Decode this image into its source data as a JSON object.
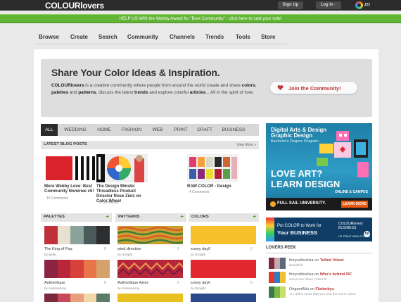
{
  "topbar": {
    "logo": "COLOURlovers",
    "signup_label": "Sign Up",
    "login_label": "Log In",
    "login_arrow": "▾"
  },
  "banner": {
    "text": "HELP US WIN the Webby Award for \"Best Community\" - click here to cast your vote!"
  },
  "nav": {
    "items": [
      "Browse",
      "Create",
      "Search",
      "Community",
      "Channels",
      "Trends",
      "Tools",
      "Store"
    ]
  },
  "hero": {
    "title": "Share Your Color Ideas & Inspiration.",
    "text_parts": [
      "COLOURlovers",
      " is a creative community where people from around the world create and share ",
      "colors",
      ", ",
      "palettes",
      " and ",
      "patterns",
      ", discuss the latest ",
      "trends",
      " and explore colorful ",
      "articles",
      "... All in the spirit of love."
    ],
    "join_label": "Join the Community!"
  },
  "tabs": [
    "ALL",
    "WEDDING",
    "HOME",
    "FASHION",
    "WEB",
    "PRINT",
    "CRAFT",
    "BUSINESS"
  ],
  "blog": {
    "header": "LATEST BLOG POSTS",
    "view_more": "View More »",
    "posts": [
      {
        "title": "More Webby Love: Best Community Nominee x5!",
        "comments": "13 Comments"
      },
      {
        "title": "The Design Minute: Threadless Product Director Rose Zietz on Color Wheel",
        "comments": "3 Comments"
      },
      {
        "title": "RAW COLOR - Design",
        "comments": "4 Comments"
      }
    ]
  },
  "palettes": {
    "header": "PALETTES",
    "plus": "+",
    "items": [
      {
        "name": "The King of Pop.",
        "user": "by kjelle_",
        "count": "0",
        "colors": [
          "#c0303a",
          "#e9e1cf",
          "#8aa39a",
          "#4a5a5b",
          "#2d2e2f"
        ]
      },
      {
        "name": "Authentique",
        "user": "by missmummy",
        "count": "0",
        "colors": [
          "#8b2342",
          "#b8263c",
          "#d8403c",
          "#e8744a",
          "#d4a26a"
        ]
      }
    ]
  },
  "patterns": {
    "header": "PATTERNS",
    "plus": "+",
    "items": [
      {
        "name": "wind direction",
        "user": "by Dsnight",
        "count": "0"
      },
      {
        "name": "Authentique Aztec",
        "user": "by missmummy",
        "count": "0"
      }
    ]
  },
  "colors_section": {
    "header": "COLORS",
    "plus": "+",
    "items": [
      {
        "name": "sunny day0",
        "user": "by Dsnight",
        "count": "0",
        "hex": "#f5c02a"
      },
      {
        "name": "sunny day0",
        "user": "by Dsnight",
        "count": "0",
        "hex": "#e3272f"
      }
    ]
  },
  "ad1": {
    "line1": "Digital Arts & Design",
    "line2": "Graphic Design",
    "line3": "Bachelor's Degree Program",
    "big1": "LOVE ART?",
    "big2": "LEARN DESIGN",
    "online": "ONLINE & CAMPUS",
    "school": "FULL SAIL UNIVERSITY.",
    "cta": "LEARN MORE"
  },
  "ad2": {
    "line1": "Put COLOR to Work for",
    "line2": "Your BUSINESS",
    "brand": "COLOURlovers BUSINESS",
    "brand_sub": "HP PRINT WEB STUDIO",
    "hp": "hp"
  },
  "peek": {
    "header": "LOVERS PEEK",
    "items": [
      {
        "user": "theycallmelisa",
        "action": " on ",
        "target": "Tufted Velvet",
        "note": "beautiful!",
        "thumb": [
          "#7a2a3a",
          "#c8a8b0",
          "#5a6a7a"
        ]
      },
      {
        "user": "theycallmelisa",
        "action": " on ",
        "target": "Who's behind RC",
        "note": "wow! love these colours!!",
        "thumb": [
          "#e3392a",
          "#2a7fc8",
          "#f0c030"
        ]
      },
      {
        "user": "OrigamiMei",
        "action": " on ",
        "target": "Flutterbys",
        "note": ":D I didn't know that you had the same name",
        "thumb": [
          "#3a7a4a",
          "#7ab84a",
          "#c8e06a"
        ]
      }
    ]
  },
  "colors": {
    "topbar": "#2b2b2b",
    "banner": "#62b436",
    "join_accent": "#b33333",
    "plus_green": "#4a9a2c"
  }
}
